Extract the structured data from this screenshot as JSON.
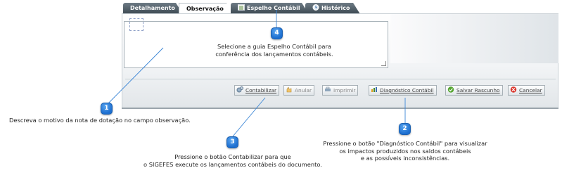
{
  "tabs": [
    {
      "label": "Detalhamento",
      "state": "inactive"
    },
    {
      "label": "Observação",
      "state": "active"
    },
    {
      "label": "Espelho Contábil",
      "state": "inactive",
      "icon": "ledger-icon"
    },
    {
      "label": "Histórico",
      "state": "inactive",
      "icon": "history-icon"
    }
  ],
  "observation_field": {
    "value": ""
  },
  "buttons": {
    "contabilizar": "Contabilizar",
    "anular": "Anular",
    "imprimir": "Imprimir",
    "diagnostico": "Diagnóstico Contábil",
    "salvar_rascunho": "Salvar Rascunho",
    "cancelar": "Cancelar"
  },
  "callouts": {
    "c1": {
      "number": "1",
      "text": "Descreva o motivo da nota de dotação no campo observação."
    },
    "c2": {
      "number": "2",
      "line1": "Pressione o botão \"Diagnóstico Contábil\"  para visualizar",
      "line2": "os impactos produzidos nos saldos contábeis",
      "line3": "e as possíveis inconsistências."
    },
    "c3": {
      "number": "3",
      "line1": "Pressione o botão Contabilizar para que",
      "line2": "o SIGEFES execute os lançamentos contábeis do documento."
    },
    "c4": {
      "number": "4",
      "line1": "Selecione a guia Espelho Contábil para",
      "line2": "conferência dos lançamentos contábeis."
    }
  },
  "colors": {
    "callout_blue": "#1d6fd0",
    "tab_dark": "#3c4952",
    "connector": "#3b86d6"
  }
}
